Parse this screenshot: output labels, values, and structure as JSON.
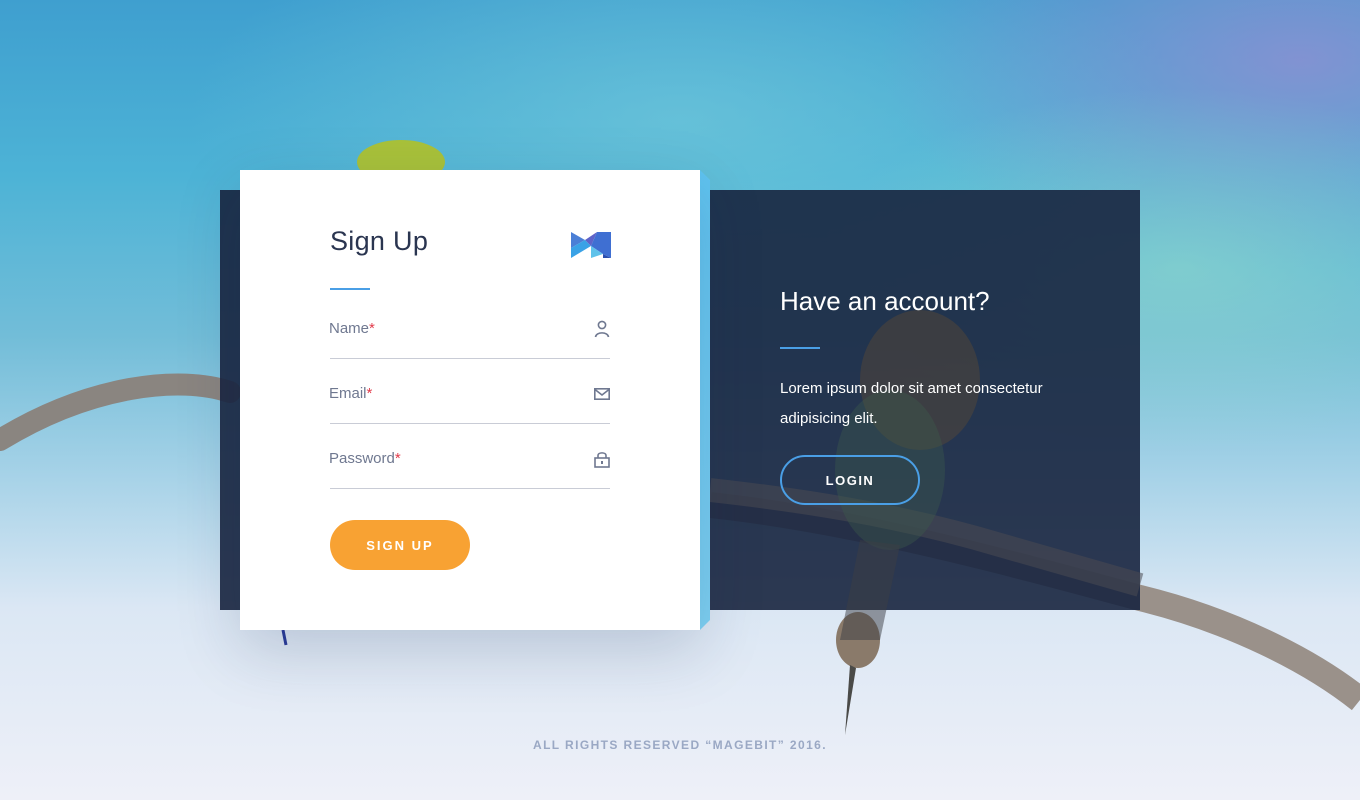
{
  "signup": {
    "title": "Sign Up",
    "fields": [
      {
        "label": "Name",
        "required_mark": "*",
        "icon": "user-icon"
      },
      {
        "label": "Email",
        "required_mark": "*",
        "icon": "envelope-icon"
      },
      {
        "label": "Password",
        "required_mark": "*",
        "icon": "lock-icon"
      }
    ],
    "button": "SIGN UP",
    "logo": "magebit-logo"
  },
  "login_panel": {
    "title": "Have an account?",
    "text": "Lorem ipsum dolor sit amet consectetur adipisicing elit.",
    "button": "LOGIN"
  },
  "footer": "ALL RIGHTS RESERVED “MAGEBIT” 2016.",
  "colors": {
    "accent": "#4a9fe6",
    "signup_button": "#f8a233",
    "panel_background": "#18253f",
    "required": "#e23b4b"
  }
}
